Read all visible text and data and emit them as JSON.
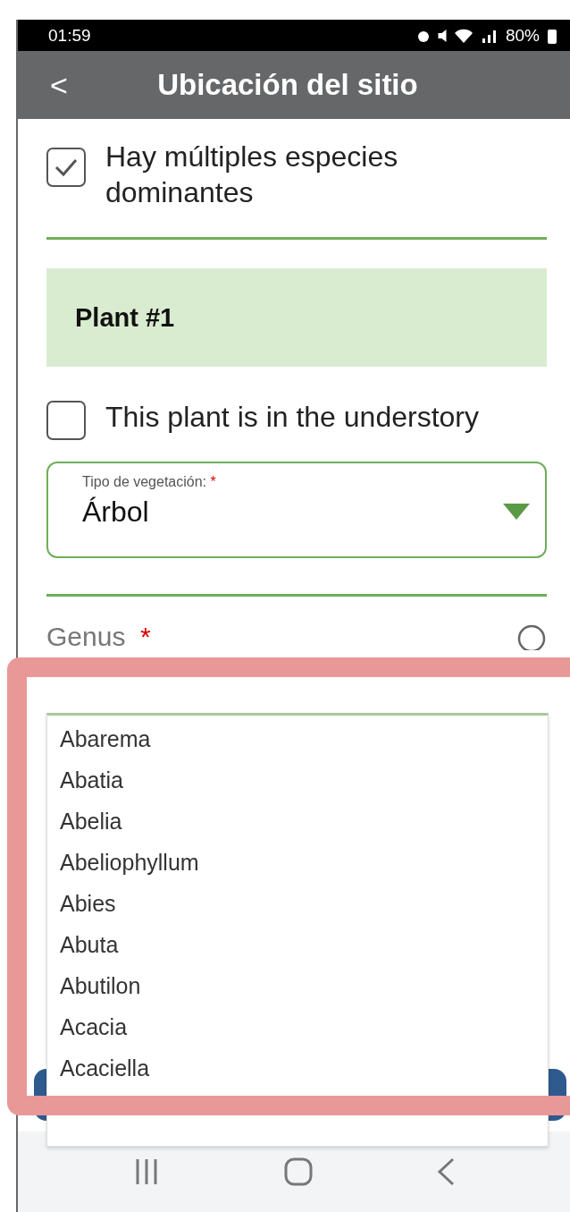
{
  "status_bar": {
    "time": "01:59",
    "battery": "80%"
  },
  "header": {
    "back": "<",
    "title": "Ubicación del sitio"
  },
  "multiple_species": {
    "label": "Hay múltiples especies dominantes",
    "checked": true
  },
  "plant": {
    "title": "Plant #1",
    "understory": {
      "label": "This plant is in the understory",
      "checked": false
    },
    "vegetation_type": {
      "label": "Tipo de vegetación:",
      "required_mark": "*",
      "value": "Árbol"
    },
    "genus": {
      "label": "Genus",
      "required_mark": "*"
    }
  },
  "genus_options": [
    {
      "label": "Abarema"
    },
    {
      "label": "Abatia"
    },
    {
      "label": "Abelia"
    },
    {
      "label": "Abeliophyllum"
    },
    {
      "label": "Abies"
    },
    {
      "label": "Abuta"
    },
    {
      "label": "Abutilon"
    },
    {
      "label": "Acacia"
    },
    {
      "label": "Acaciella"
    }
  ]
}
